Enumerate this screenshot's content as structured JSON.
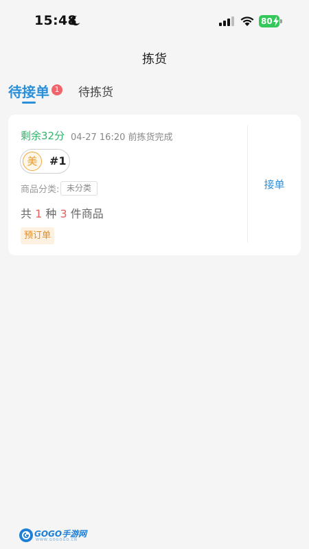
{
  "status_bar": {
    "time": "15:48",
    "battery": "80",
    "battery_color": "#34c759"
  },
  "header": {
    "title": "拣货"
  },
  "tabs": [
    {
      "label": "待接单",
      "badge": "1",
      "active": true
    },
    {
      "label": "待拣货",
      "active": false
    }
  ],
  "order": {
    "remaining": "剩余32分",
    "deadline": "04-27 16:20 前拣货完成",
    "platform_logo": "美",
    "order_no": "#1",
    "category_label": "商品分类:",
    "category_value": "未分类",
    "summary": {
      "prefix": "共",
      "kinds": "1",
      "mid1": "种",
      "items": "3",
      "suffix": "件商品"
    },
    "badge": "预订单",
    "accept_label": "接单"
  },
  "watermark": {
    "brand": "GOGO手游网",
    "url": "WWW.GOGOGO.CN"
  },
  "colors": {
    "accent": "#2a8fd9",
    "remaining": "#2fb36b",
    "highlight": "#e8605c",
    "preorder": "#e48a1f"
  }
}
